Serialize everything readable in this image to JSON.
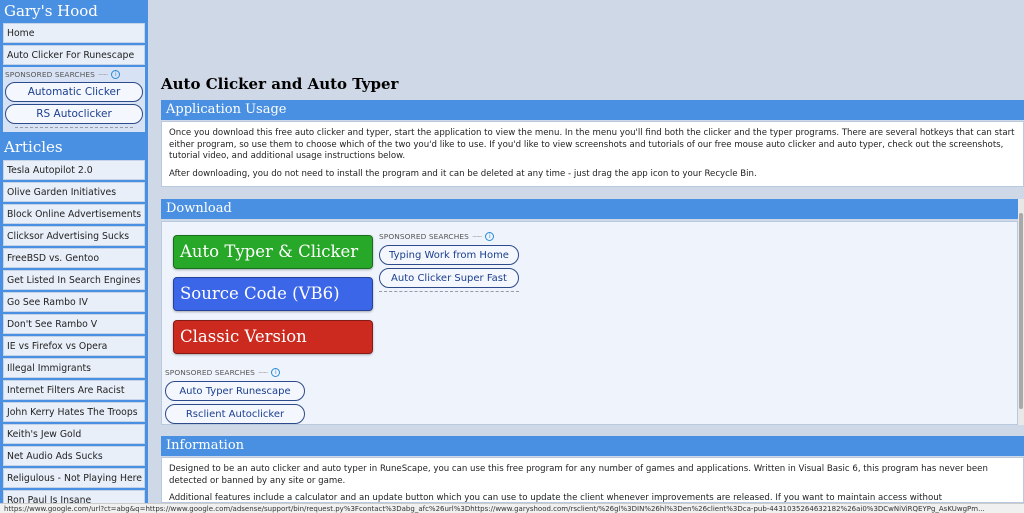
{
  "sidebar": {
    "title": "Gary's Hood",
    "top_items": [
      {
        "label": "Home"
      },
      {
        "label": "Auto Clicker For Runescape"
      }
    ],
    "sponsored": {
      "header": "SPONSORED SEARCHES",
      "links": [
        "Automatic Clicker",
        "RS Autoclicker"
      ]
    },
    "articles_heading": "Articles",
    "articles": [
      {
        "label": "Tesla Autopilot 2.0"
      },
      {
        "label": "Olive Garden Initiatives"
      },
      {
        "label": "Block Online Advertisements"
      },
      {
        "label": "Clicksor Advertising Sucks"
      },
      {
        "label": "FreeBSD vs. Gentoo"
      },
      {
        "label": "Get Listed In Search Engines"
      },
      {
        "label": "Go See Rambo IV"
      },
      {
        "label": "Don't See Rambo V"
      },
      {
        "label": "IE vs Firefox vs Opera"
      },
      {
        "label": "Illegal Immigrants"
      },
      {
        "label": "Internet Filters Are Racist"
      },
      {
        "label": "John Kerry Hates The Troops"
      },
      {
        "label": "Keith's Jew Gold"
      },
      {
        "label": "Net Audio Ads Sucks"
      },
      {
        "label": "Religulous - Not Playing Here"
      },
      {
        "label": "Ron Paul Is Insane"
      }
    ]
  },
  "main": {
    "title": "Auto Clicker and Auto Typer",
    "usage": {
      "heading": "Application Usage",
      "p1": "Once you download this free auto clicker and typer, start the application to view the menu. In the menu you'll find both the clicker and the typer programs. There are several hotkeys that can start either program, so use them to choose which of the two you'd like to use. If you'd like to view screenshots and tutorials of our free mouse auto clicker and auto typer, check out the screenshots, tutorial video, and additional usage instructions below.",
      "p2": "After downloading, you do not need to install the program and it can be deleted at any time - just drag the app icon to your Recycle Bin."
    },
    "download": {
      "heading": "Download",
      "buttons": [
        {
          "label": "Auto Typer & Clicker",
          "color": "#28a828"
        },
        {
          "label": "Source Code (VB6)",
          "color": "#3b66e8"
        },
        {
          "label": "Classic Version",
          "color": "#cc2a1f"
        }
      ],
      "sponsored_right": {
        "header": "SPONSORED SEARCHES",
        "links": [
          "Typing Work from Home",
          "Auto Clicker Super Fast"
        ]
      },
      "sponsored_bottom": {
        "header": "SPONSORED SEARCHES",
        "links": [
          "Auto Typer Runescape",
          "Rsclient Autoclicker"
        ]
      }
    },
    "information": {
      "heading": "Information",
      "p1": "Designed to be an auto clicker and auto typer in RuneScape, you can use this free program for any number of games and applications. Written in Visual Basic 6, this program has never been detected or banned by any site or game.",
      "p2": "Additional features include a calculator and an update button which you can use to update the client whenever improvements are released. If you want to maintain access without"
    }
  },
  "statusbar": {
    "url": "https://www.google.com/url?ct=abg&q=https://www.google.com/adsense/support/bin/request.py%3Fcontact%3Dabg_afc%26url%3Dhttps://www.garyshood.com/rsclient/%26gl%3DIN%26hl%3Den%26client%3Dca-pub-4431035264632182%26ai0%3DCwNiViRQEYPg_AsKUwgPm..."
  },
  "colors": {
    "accent": "#4a90e2",
    "background": "#cfd8e6"
  }
}
